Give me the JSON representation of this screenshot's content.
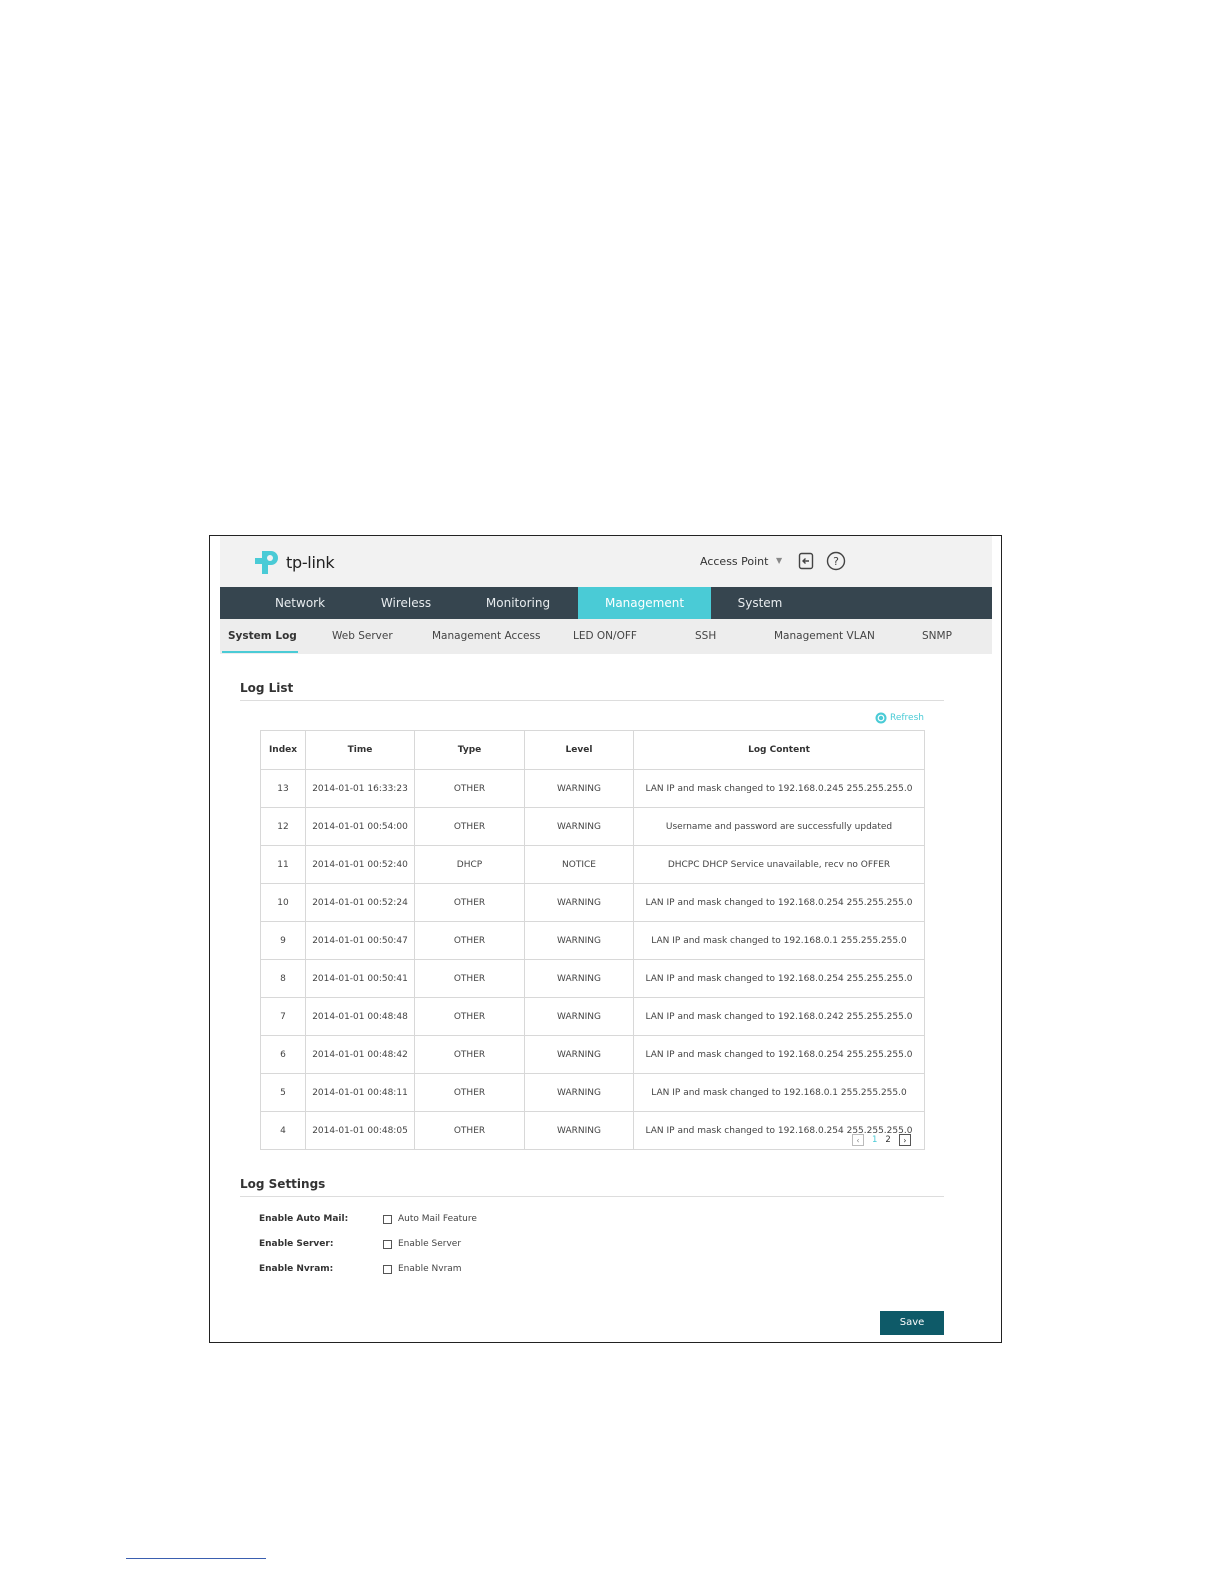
{
  "header": {
    "brand": "tp-link",
    "mode": "Access Point",
    "logout_icon": "logout-icon",
    "help_icon": "help-icon"
  },
  "topnav": [
    {
      "label": "Network"
    },
    {
      "label": "Wireless"
    },
    {
      "label": "Monitoring"
    },
    {
      "label": "Management",
      "active": true
    },
    {
      "label": "System"
    }
  ],
  "subnav": [
    {
      "label": "System Log",
      "active": true
    },
    {
      "label": "Web Server"
    },
    {
      "label": "Management Access"
    },
    {
      "label": "LED ON/OFF"
    },
    {
      "label": "SSH"
    },
    {
      "label": "Management VLAN"
    },
    {
      "label": "SNMP"
    }
  ],
  "log_list": {
    "title": "Log List",
    "refresh_label": "Refresh",
    "columns": [
      "Index",
      "Time",
      "Type",
      "Level",
      "Log Content"
    ],
    "rows": [
      [
        "13",
        "2014-01-01 16:33:23",
        "OTHER",
        "WARNING",
        "LAN IP and mask changed to 192.168.0.245 255.255.255.0"
      ],
      [
        "12",
        "2014-01-01 00:54:00",
        "OTHER",
        "WARNING",
        "Username and password are successfully updated"
      ],
      [
        "11",
        "2014-01-01 00:52:40",
        "DHCP",
        "NOTICE",
        "DHCPC DHCP Service unavailable, recv no OFFER"
      ],
      [
        "10",
        "2014-01-01 00:52:24",
        "OTHER",
        "WARNING",
        "LAN IP and mask changed to 192.168.0.254 255.255.255.0"
      ],
      [
        "9",
        "2014-01-01 00:50:47",
        "OTHER",
        "WARNING",
        "LAN IP and mask changed to 192.168.0.1 255.255.255.0"
      ],
      [
        "8",
        "2014-01-01 00:50:41",
        "OTHER",
        "WARNING",
        "LAN IP and mask changed to 192.168.0.254 255.255.255.0"
      ],
      [
        "7",
        "2014-01-01 00:48:48",
        "OTHER",
        "WARNING",
        "LAN IP and mask changed to 192.168.0.242 255.255.255.0"
      ],
      [
        "6",
        "2014-01-01 00:48:42",
        "OTHER",
        "WARNING",
        "LAN IP and mask changed to 192.168.0.254 255.255.255.0"
      ],
      [
        "5",
        "2014-01-01 00:48:11",
        "OTHER",
        "WARNING",
        "LAN IP and mask changed to 192.168.0.1 255.255.255.0"
      ],
      [
        "4",
        "2014-01-01 00:48:05",
        "OTHER",
        "WARNING",
        "LAN IP and mask changed to 192.168.0.254 255.255.255.0"
      ]
    ],
    "pagination": {
      "pages": [
        "1",
        "2"
      ],
      "current": "1"
    }
  },
  "log_settings": {
    "title": "Log Settings",
    "auto_mail_label": "Enable Auto Mail:",
    "auto_mail_text": "Auto Mail Feature",
    "server_label": "Enable Server:",
    "server_text": "Enable Server",
    "nvram_label": "Enable Nvram:",
    "nvram_text": "Enable Nvram"
  },
  "save_label": "Save",
  "colors": {
    "accent": "#4acbd6",
    "nav_bg": "#36454f",
    "save_bg": "#0e5a68"
  }
}
